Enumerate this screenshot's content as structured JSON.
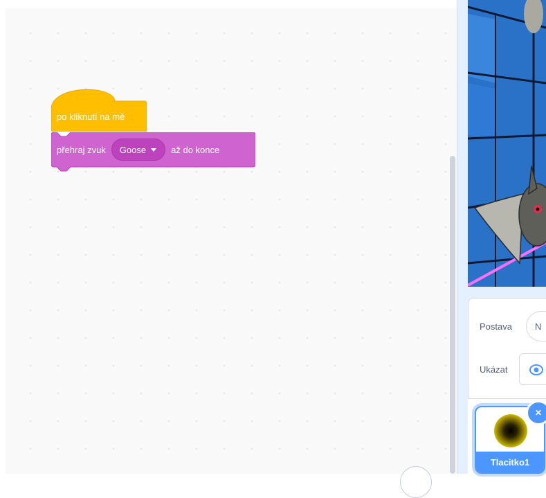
{
  "workspace": {
    "hat_block_label": "po kliknutí na mě",
    "sound_block": {
      "prefix": "přehraj zvuk",
      "sound_value": "Goose",
      "suffix": "až do konce"
    }
  },
  "sprite_info": {
    "name_label": "Postava",
    "name_value": "N",
    "show_label": "Ukázat"
  },
  "sprite_list": {
    "sprites": [
      {
        "name": "Tlacitko1",
        "selected": true
      }
    ]
  },
  "colors": {
    "event_block": "#ffbf00",
    "sound_block": "#cf63cf",
    "accent": "#4c97ff"
  },
  "icons": {
    "dropdown": "caret-down-icon",
    "show": "eye-icon",
    "delete": "trash-icon"
  }
}
